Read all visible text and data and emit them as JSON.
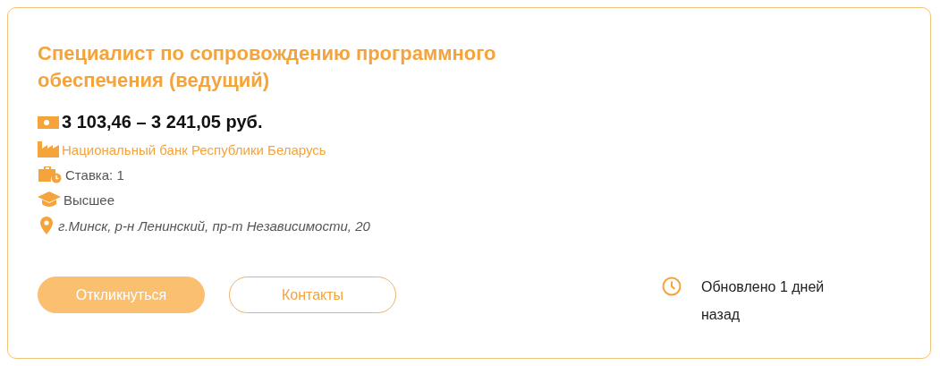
{
  "vacancy": {
    "title": "Специалист по сопровождению программного обеспечения (ведущий)",
    "details": [
      {
        "kind": "salary",
        "text": "3 103,46 – 3 241,05 руб."
      },
      {
        "kind": "employer",
        "text": "Национальный банк Республики Беларусь"
      },
      {
        "kind": "rate",
        "text": "Ставка: 1"
      },
      {
        "kind": "education",
        "text": "Высшее"
      },
      {
        "kind": "address",
        "text": "г.Минск, р-н Ленинский, пр-т Независимости, 20"
      }
    ],
    "buttons": [
      {
        "kind": "primary",
        "label": "Откликнуться"
      },
      {
        "kind": "outline",
        "label": "Контакты"
      }
    ],
    "updated": "Обновлено 1 дней назад"
  }
}
